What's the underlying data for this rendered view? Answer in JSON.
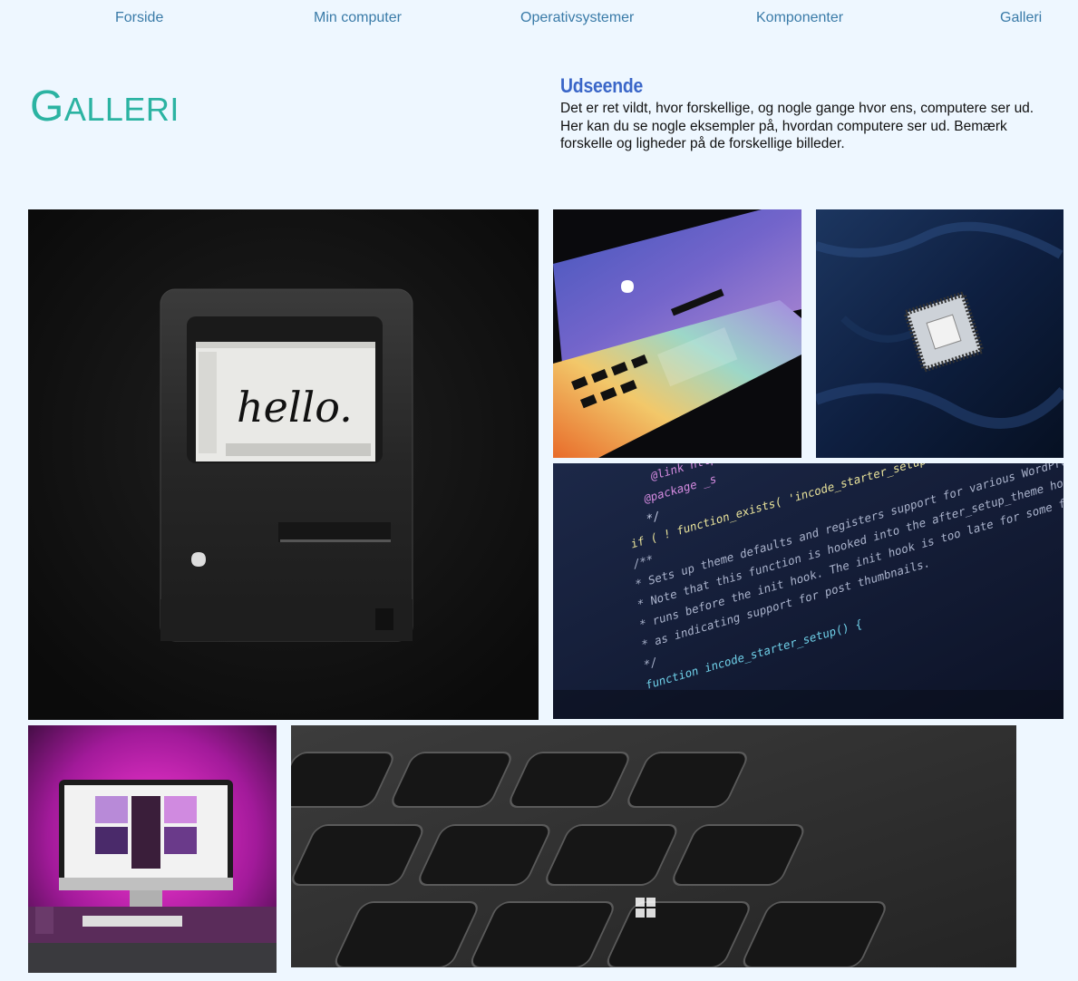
{
  "nav": {
    "items": [
      {
        "label": "Forside"
      },
      {
        "label": "Min computer"
      },
      {
        "label": "Operativsystemer"
      },
      {
        "label": "Komponenter"
      },
      {
        "label": "Galleri"
      }
    ]
  },
  "header": {
    "title_first": "G",
    "title_rest": "ALLERI"
  },
  "intro": {
    "heading": "Udseende",
    "text": "Det er ret vildt, hvor forskellige, og nogle gange hvor ens, computere ser ud. Her kan du se nogle eksempler på, hvordan computere ser ud. Bemærk forskelle og ligheder på de forskellige billeder."
  },
  "gallery": {
    "images": [
      {
        "icon": "vintage-macintosh-image",
        "screen_text": "hello."
      },
      {
        "icon": "macbook-image"
      },
      {
        "icon": "cpu-chip-image"
      },
      {
        "icon": "code-screen-image",
        "code_lines": [
          "@link https://developer.wordpress.org",
          "@package _s",
          "*/",
          "if ( ! function_exists( 'incode_starter_setup' ) ) :",
          "/**",
          " * Sets up theme defaults and registers support for various WordPress features.",
          " * Note that this function is hooked into the after_setup_theme hook, which",
          " * runs before the init hook. The init hook is too late for some features,",
          " * as indicating support for post thumbnails.",
          " */",
          "function incode_starter_setup() {"
        ]
      },
      {
        "icon": "imac-neon-desk-image"
      },
      {
        "icon": "keyboard-closeup-image"
      }
    ]
  }
}
